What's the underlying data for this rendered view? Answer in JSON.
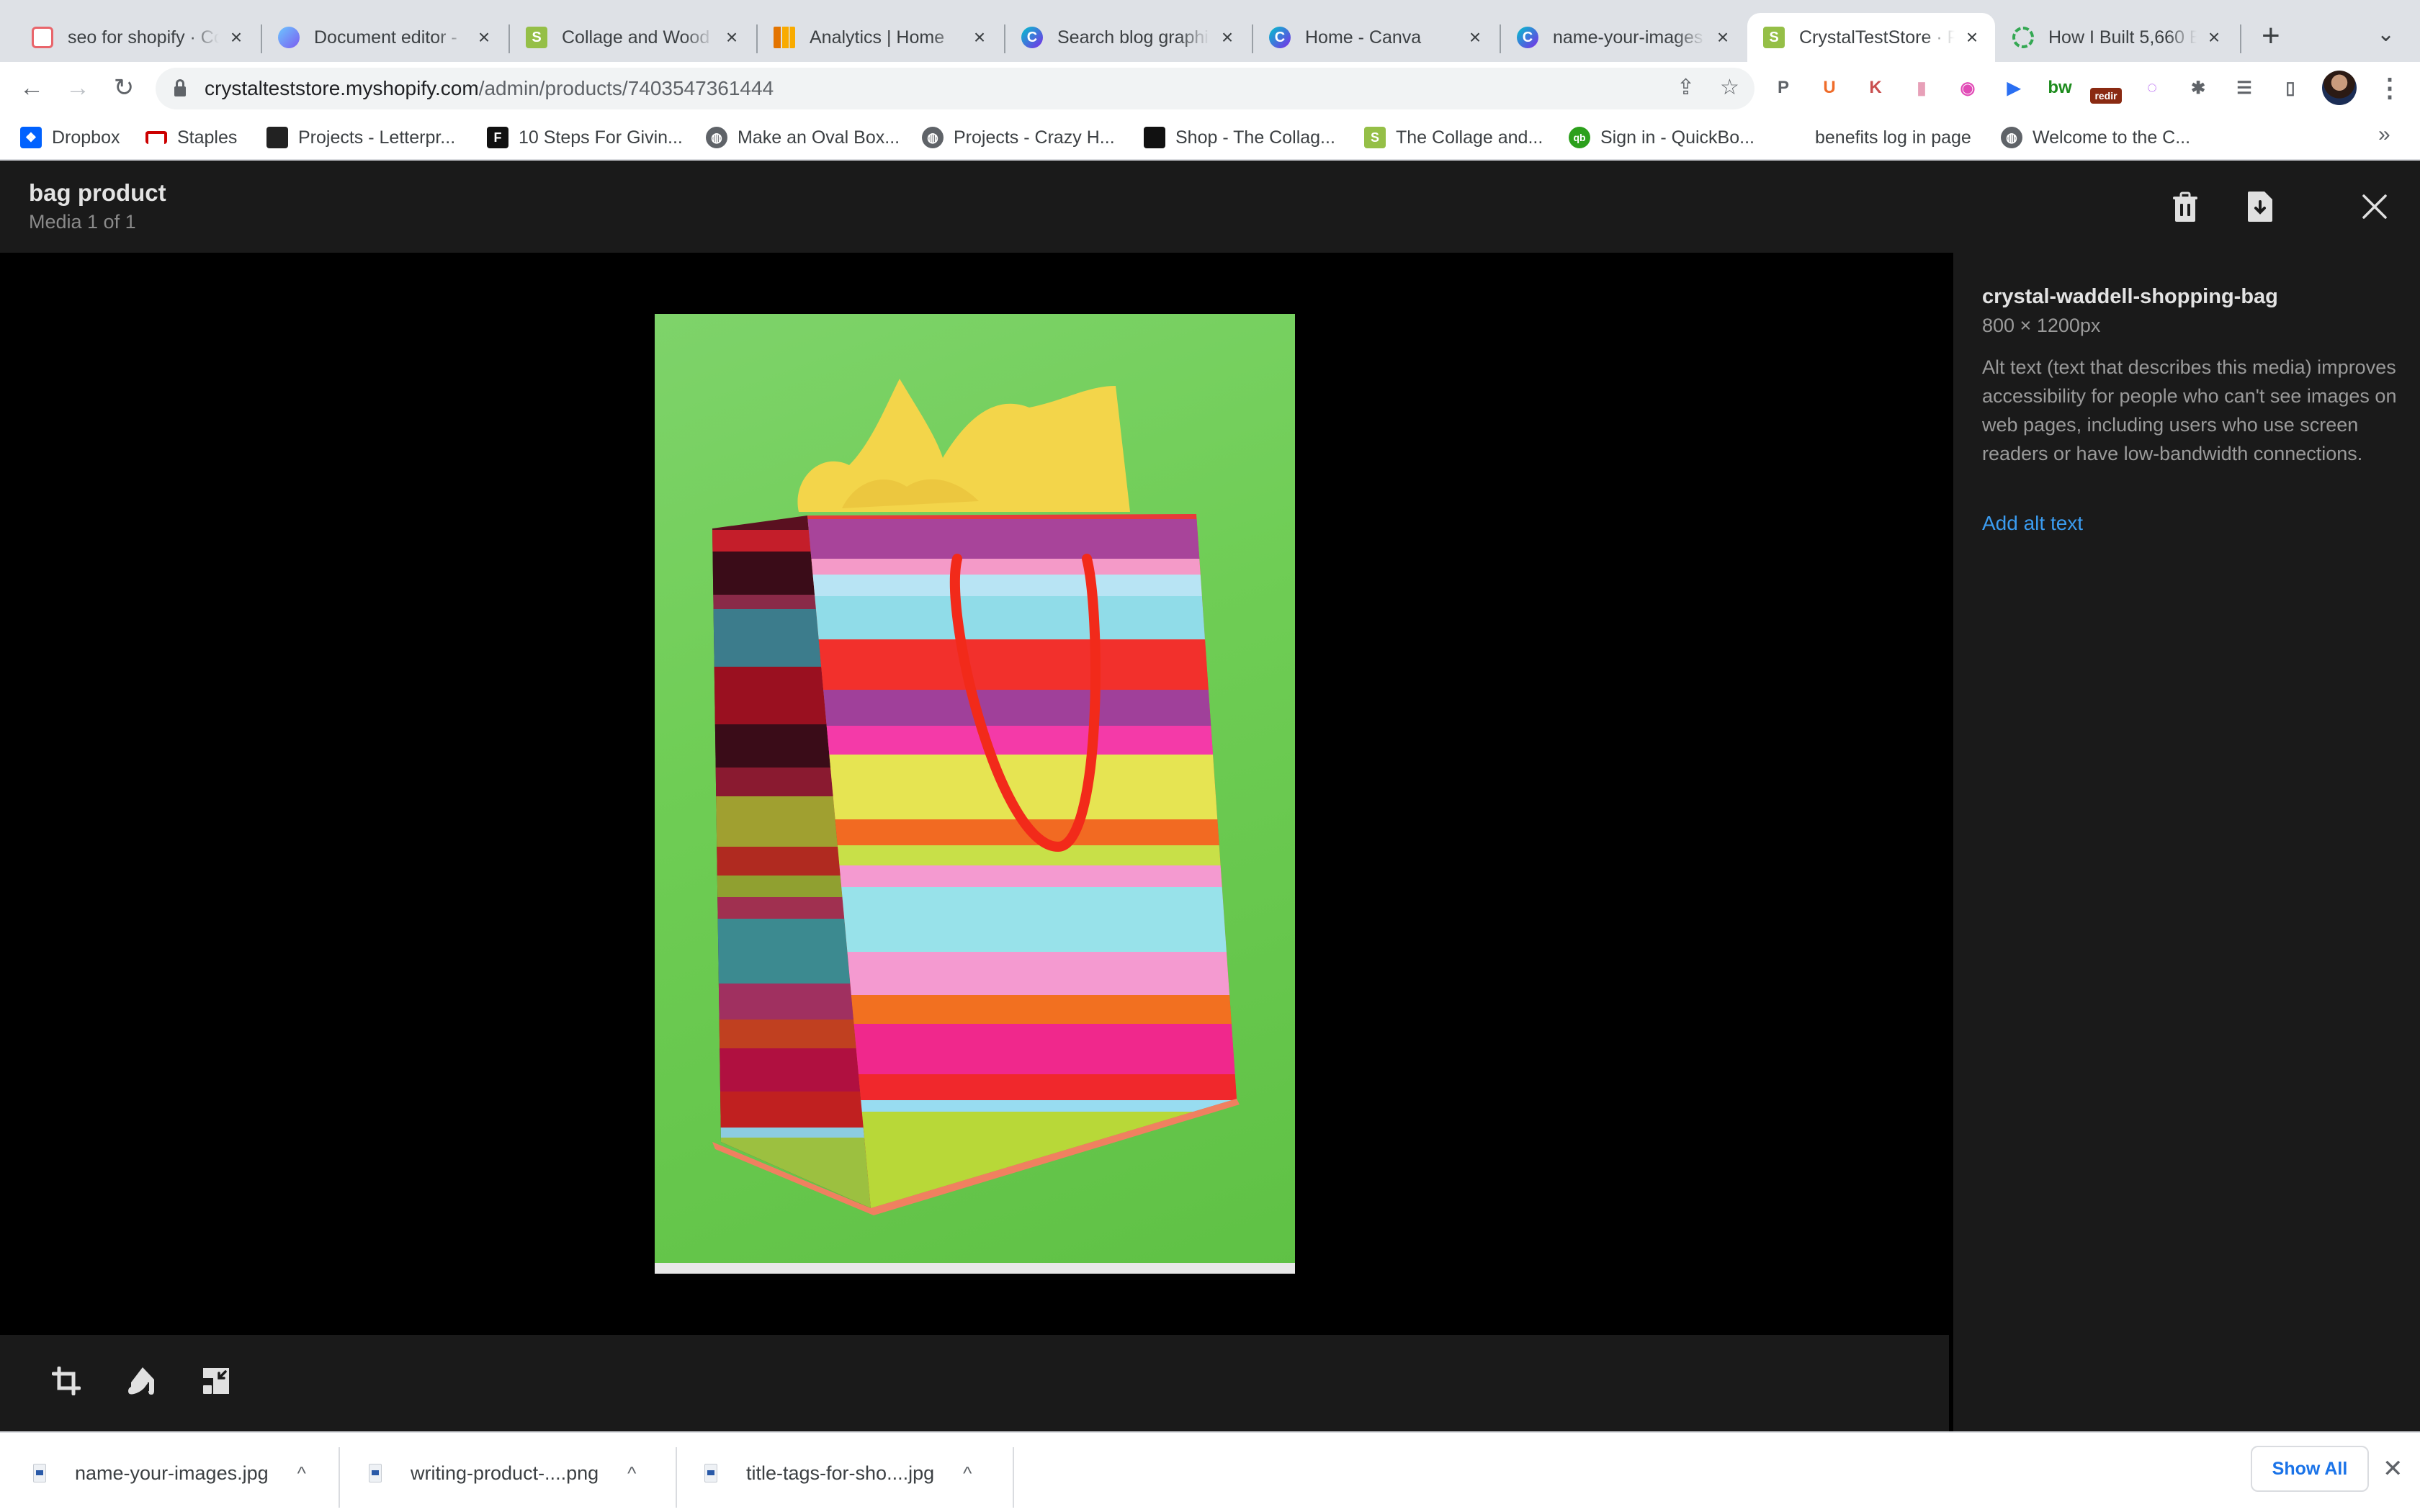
{
  "browser": {
    "tabs": [
      {
        "title": "seo for shopify · Co",
        "favicon": "analytics-doc-icon",
        "color": "#e9656b",
        "active": false
      },
      {
        "title": "Document editor - ",
        "favicon": "document-editor-icon",
        "color": "#7b5cf0",
        "active": false
      },
      {
        "title": "Collage and Wood",
        "favicon": "shopify-icon",
        "color": "#95bf47",
        "active": false
      },
      {
        "title": "Analytics | Home",
        "favicon": "google-analytics-icon",
        "color": "#f9ab00",
        "active": false
      },
      {
        "title": "Search blog graphi",
        "favicon": "canva-icon",
        "color": "#2c8ae8",
        "active": false
      },
      {
        "title": "Home - Canva",
        "favicon": "canva-icon",
        "color": "#2c8ae8",
        "active": false
      },
      {
        "title": "name-your-images",
        "favicon": "canva-icon",
        "color": "#2c8ae8",
        "active": false
      },
      {
        "title": "CrystalTestStore · P",
        "favicon": "shopify-icon",
        "color": "#95bf47",
        "active": true
      },
      {
        "title": "How I Built 5,660 B",
        "favicon": "loading-circle-icon",
        "color": "#34a853",
        "active": false
      }
    ],
    "new_tab_label": "+",
    "tab_search_label": "⌄",
    "url_host": "crystalteststore.myshopify.com",
    "url_path": "/admin/products/7403547361444",
    "extensions": [
      {
        "name": "pinterest-extension-icon",
        "glyph": "P",
        "color": "#5f6368"
      },
      {
        "name": "u-extension-icon",
        "glyph": "U",
        "color": "#ef6c2a"
      },
      {
        "name": "k-extension-icon",
        "glyph": "K",
        "color": "#c94f4f"
      },
      {
        "name": "chart-extension-icon",
        "glyph": "▮",
        "color": "#e7a0b8"
      },
      {
        "name": "camera-extension-icon",
        "glyph": "◉",
        "color": "#e14bb6"
      },
      {
        "name": "arrow-extension-icon",
        "glyph": "▶",
        "color": "#2a6ff2"
      },
      {
        "name": "bw-extension-icon",
        "glyph": "bw",
        "color": "#1c8b1c"
      },
      {
        "name": "redirect-extension-icon",
        "glyph": "redir",
        "color": "#8a2a12"
      },
      {
        "name": "merlin-extension-icon",
        "glyph": "◌",
        "color": "#b15cf0"
      },
      {
        "name": "puzzle-extensions-icon",
        "glyph": "✱",
        "color": "#5f6368"
      },
      {
        "name": "media-control-icon",
        "glyph": "☰",
        "color": "#5f6368"
      },
      {
        "name": "side-panel-icon",
        "glyph": "▯",
        "color": "#5f6368"
      }
    ],
    "bookmarks": [
      {
        "label": "Dropbox",
        "icon": "dropbox-icon",
        "color": "#0061fe"
      },
      {
        "label": "Staples",
        "icon": "staples-icon",
        "color": "#cc0000"
      },
      {
        "label": "Projects - Letterpr...",
        "icon": "letterpress-icon",
        "color": "#222222"
      },
      {
        "label": "10 Steps For Givin...",
        "icon": "f-icon",
        "color": "#111111"
      },
      {
        "label": "Make an Oval Box...",
        "icon": "globe-icon",
        "color": "#5f6368"
      },
      {
        "label": "Projects - Crazy H...",
        "icon": "globe-icon",
        "color": "#5f6368"
      },
      {
        "label": "Shop - The Collag...",
        "icon": "collage-icon",
        "color": "#111111"
      },
      {
        "label": "The Collage and...",
        "icon": "shopify-icon",
        "color": "#95bf47"
      },
      {
        "label": "Sign in - QuickBo...",
        "icon": "quickbooks-icon",
        "color": "#2ca01c"
      },
      {
        "label": "benefits log in page",
        "icon": "",
        "color": ""
      },
      {
        "label": "Welcome to the C...",
        "icon": "globe-icon",
        "color": "#5f6368"
      }
    ],
    "bookmarks_overflow": "»"
  },
  "viewer": {
    "title": "bag product",
    "subtitle": "Media 1 of 1",
    "image_alt": "Striped shopping bag with yellow tissue on green background"
  },
  "sidebar": {
    "file_name": "crystal-waddell-shopping-bag",
    "dimensions": "800 × 1200px",
    "description": "Alt text (text that describes this media) improves accessibility for people who can't see images on web pages, including users who use screen readers or have low-bandwidth connections.",
    "add_alt_text": "Add alt text",
    "link_color": "#3b9cf0"
  },
  "downloads": {
    "items": [
      {
        "name": "name-your-images.jpg"
      },
      {
        "name": "writing-product-....png"
      },
      {
        "name": "title-tags-for-sho....jpg"
      }
    ],
    "caret": "^",
    "show_all": "Show All",
    "close": "✕"
  }
}
